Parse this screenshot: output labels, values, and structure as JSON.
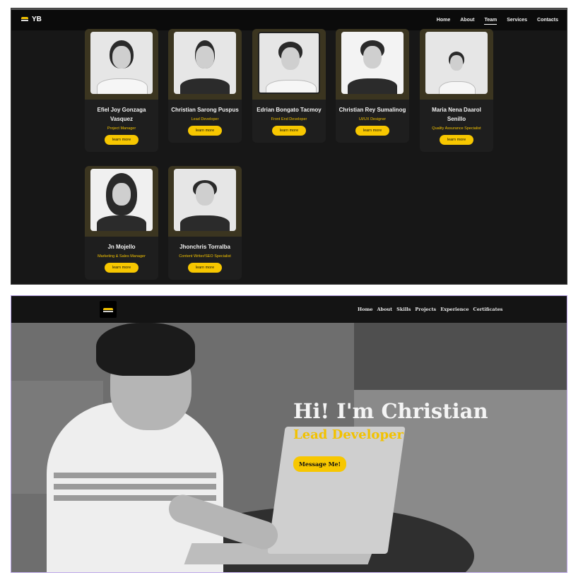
{
  "team_page": {
    "logo_text": "YB",
    "nav": [
      "Home",
      "About",
      "Team",
      "Services",
      "Contacts"
    ],
    "active_nav": "Team",
    "members": [
      {
        "name": "Efiel Joy Gonzaga Vasquez",
        "role": "Project Manager",
        "button": "learn more"
      },
      {
        "name": "Christian Sarong Puspus",
        "role": "Lead Developer",
        "button": "learn more"
      },
      {
        "name": "Edrian Bongato Tacmoy",
        "role": "Front End Developer",
        "button": "learn more"
      },
      {
        "name": "Christian Rey Sumalinog",
        "role": "UI/UX Designer",
        "button": "learn more"
      },
      {
        "name": "Maria Nena Daarol Senillo",
        "role": "Quality Assurance Specialist",
        "button": "learn more"
      },
      {
        "name": "Jn Mojello",
        "role": "Marketing & Sales Manager",
        "button": "learn more"
      },
      {
        "name": "Jhonchris Torralba",
        "role": "Content Writer/SEO Specialist",
        "button": "learn more"
      }
    ]
  },
  "portfolio_page": {
    "nav": [
      "Home",
      "About",
      "Skills",
      "Projects",
      "Experience",
      "Certificates"
    ],
    "hero_title": "Hi! I'm Christian",
    "hero_subtitle": "Lead Developer",
    "cta_button": "Message Me!"
  },
  "colors": {
    "accent": "#f7c700",
    "background_dark": "#171717",
    "card": "#1e1e1e"
  }
}
